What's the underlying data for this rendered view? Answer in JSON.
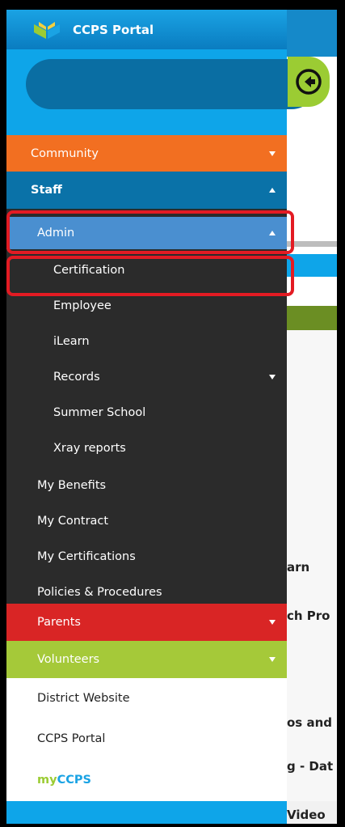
{
  "header": {
    "title": "CCPS Portal",
    "logo_icon": "book-logo-icon"
  },
  "search": {
    "placeholder": "",
    "back_icon": "circle-arrow-left-icon"
  },
  "nav": {
    "community": "Community",
    "staff": "Staff",
    "admin": "Admin",
    "admin_items": [
      "Certification",
      "Employee",
      "iLearn",
      "Records",
      "Summer School",
      "Xray reports"
    ],
    "staff_items": [
      "My Benefits",
      "My Contract",
      "My Certifications",
      "Policies & Procedures"
    ],
    "parents": "Parents",
    "volunteers": "Volunteers"
  },
  "links": {
    "district": "District Website",
    "portal": "CCPS Portal",
    "myccps_my": "my",
    "myccps_ccps": "CCPS"
  },
  "background_text": [
    "arn",
    "ch Pro",
    "os and",
    "g - Dat",
    "Video"
  ],
  "colors": {
    "header_blue": "#0a7cc0",
    "community": "#f26f21",
    "staff": "#0a72a8",
    "admin": "#4a8fd0",
    "submenu": "#2b2b2b",
    "parents": "#d92525",
    "volunteers": "#a5c939",
    "highlight": "#e31b23"
  }
}
